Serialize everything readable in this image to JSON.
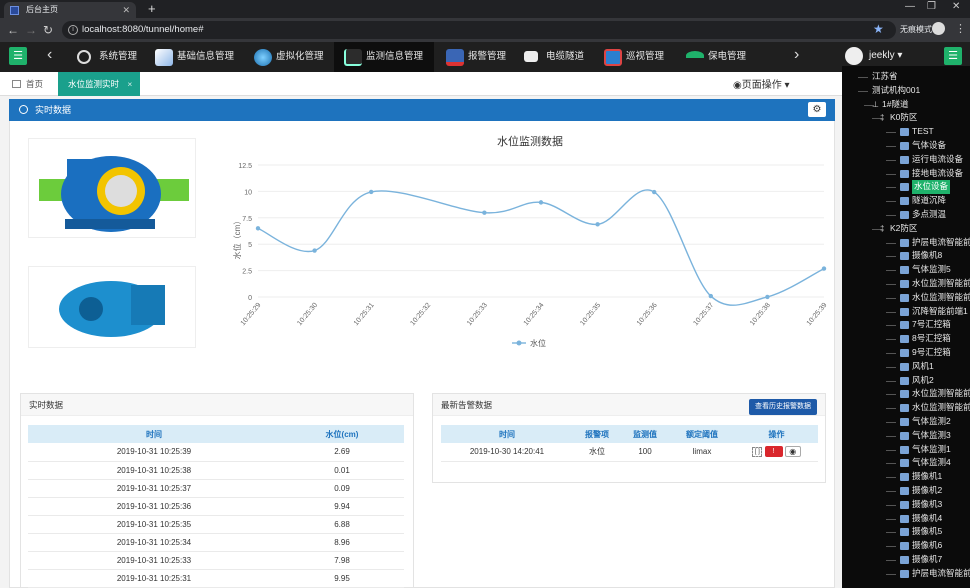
{
  "browser": {
    "tab_title": "后台主页",
    "url": "localhost:8080/tunnel/home#",
    "incognito_label": "无痕模式"
  },
  "topnav": {
    "items": [
      {
        "label": "系统管理",
        "icon": "gear-icon"
      },
      {
        "label": "基础信息管理",
        "icon": "document-icon"
      },
      {
        "label": "虚拟化管理",
        "icon": "globe-icon"
      },
      {
        "label": "监测信息管理",
        "icon": "monitor-icon"
      },
      {
        "label": "报警管理",
        "icon": "alarm-icon"
      },
      {
        "label": "电缆隧道",
        "icon": "cable-icon"
      },
      {
        "label": "巡视管理",
        "icon": "patrol-icon"
      },
      {
        "label": "保电管理",
        "icon": "umbrella-icon"
      }
    ],
    "active_index": 3,
    "user_name": "jeekly"
  },
  "subtabs": {
    "home": "首页",
    "current": "水位监测实时",
    "close": "×",
    "page_ops": "页面操作"
  },
  "panel": {
    "title": "实时数据"
  },
  "chart_data": {
    "type": "line",
    "title": "水位监测数据",
    "ylabel": "水位（cm）",
    "xlabel": "",
    "ylim": [
      0,
      12.5
    ],
    "yticks": [
      "0",
      "2.5",
      "5",
      "7.5",
      "10",
      "12.5"
    ],
    "categories": [
      "10:25:29",
      "10:25:30",
      "10:25:31",
      "10:25:32",
      "10:25:33",
      "10:25:34",
      "10:25:35",
      "10:25:36",
      "10:25:37",
      "10:25:38",
      "10:25:39"
    ],
    "series": [
      {
        "name": "水位",
        "color": "#7ab3dc",
        "points": [
          {
            "x": "10:25:29",
            "y": 6.5
          },
          {
            "x": "10:25:30",
            "y": 4.4
          },
          {
            "x": "10:25:31",
            "y": 9.95
          },
          {
            "x": "10:25:33",
            "y": 7.98
          },
          {
            "x": "10:25:34",
            "y": 8.96
          },
          {
            "x": "10:25:35",
            "y": 6.88
          },
          {
            "x": "10:25:36",
            "y": 9.94
          },
          {
            "x": "10:25:37",
            "y": 0.09
          },
          {
            "x": "10:25:38",
            "y": 0.01
          },
          {
            "x": "10:25:39",
            "y": 2.69
          }
        ]
      }
    ],
    "legend_position": "bottom",
    "grid": true
  },
  "realtime": {
    "title": "实时数据",
    "columns": [
      "时间",
      "水位(cm)"
    ],
    "rows": [
      [
        "2019-10-31 10:25:39",
        "2.69"
      ],
      [
        "2019-10-31 10:25:38",
        "0.01"
      ],
      [
        "2019-10-31 10:25:37",
        "0.09"
      ],
      [
        "2019-10-31 10:25:36",
        "9.94"
      ],
      [
        "2019-10-31 10:25:35",
        "6.88"
      ],
      [
        "2019-10-31 10:25:34",
        "8.96"
      ],
      [
        "2019-10-31 10:25:33",
        "7.98"
      ],
      [
        "2019-10-31 10:25:31",
        "9.95"
      ]
    ]
  },
  "alarm": {
    "title": "最新告警数据",
    "history_button": "查看历史报警数据",
    "columns": [
      "时间",
      "报警项",
      "监测值",
      "额定阈值",
      "操作"
    ],
    "rows": [
      [
        "2019-10-30 14:20:41",
        "水位",
        "100",
        "limax"
      ]
    ]
  },
  "tree": [
    {
      "label": "江苏省",
      "level": 0
    },
    {
      "label": "测试机构001",
      "level": 0
    },
    {
      "label": "1#隧道",
      "level": 1
    },
    {
      "label": "K0防区",
      "level": 2
    },
    {
      "label": "TEST",
      "level": 3
    },
    {
      "label": "气体设备",
      "level": 3
    },
    {
      "label": "运行电流设备",
      "level": 3
    },
    {
      "label": "接地电流设备",
      "level": 3
    },
    {
      "label": "水位设备",
      "level": 3,
      "selected": true
    },
    {
      "label": "隧道沉降",
      "level": 3
    },
    {
      "label": "多点测温",
      "level": 3
    },
    {
      "label": "K2防区",
      "level": 2
    },
    {
      "label": "护层电流智能前",
      "level": 3
    },
    {
      "label": "摄像机8",
      "level": 3
    },
    {
      "label": "气体监测5",
      "level": 3
    },
    {
      "label": "水位监测智能前",
      "level": 3
    },
    {
      "label": "水位监测智能前",
      "level": 3
    },
    {
      "label": "沉降智能前端1",
      "level": 3
    },
    {
      "label": "7号汇控箱",
      "level": 3
    },
    {
      "label": "8号汇控箱",
      "level": 3
    },
    {
      "label": "9号汇控箱",
      "level": 3
    },
    {
      "label": "风机1",
      "level": 3
    },
    {
      "label": "风机2",
      "level": 3
    },
    {
      "label": "水位监测智能前",
      "level": 3
    },
    {
      "label": "水位监测智能前",
      "level": 3
    },
    {
      "label": "气体监测2",
      "level": 3
    },
    {
      "label": "气体监测3",
      "level": 3
    },
    {
      "label": "气体监测1",
      "level": 3
    },
    {
      "label": "气体监测4",
      "level": 3
    },
    {
      "label": "摄像机1",
      "level": 3
    },
    {
      "label": "摄像机2",
      "level": 3
    },
    {
      "label": "摄像机3",
      "level": 3
    },
    {
      "label": "摄像机4",
      "level": 3
    },
    {
      "label": "摄像机5",
      "level": 3
    },
    {
      "label": "摄像机6",
      "level": 3
    },
    {
      "label": "摄像机7",
      "level": 3
    },
    {
      "label": "护层电流智能前",
      "level": 3
    }
  ]
}
